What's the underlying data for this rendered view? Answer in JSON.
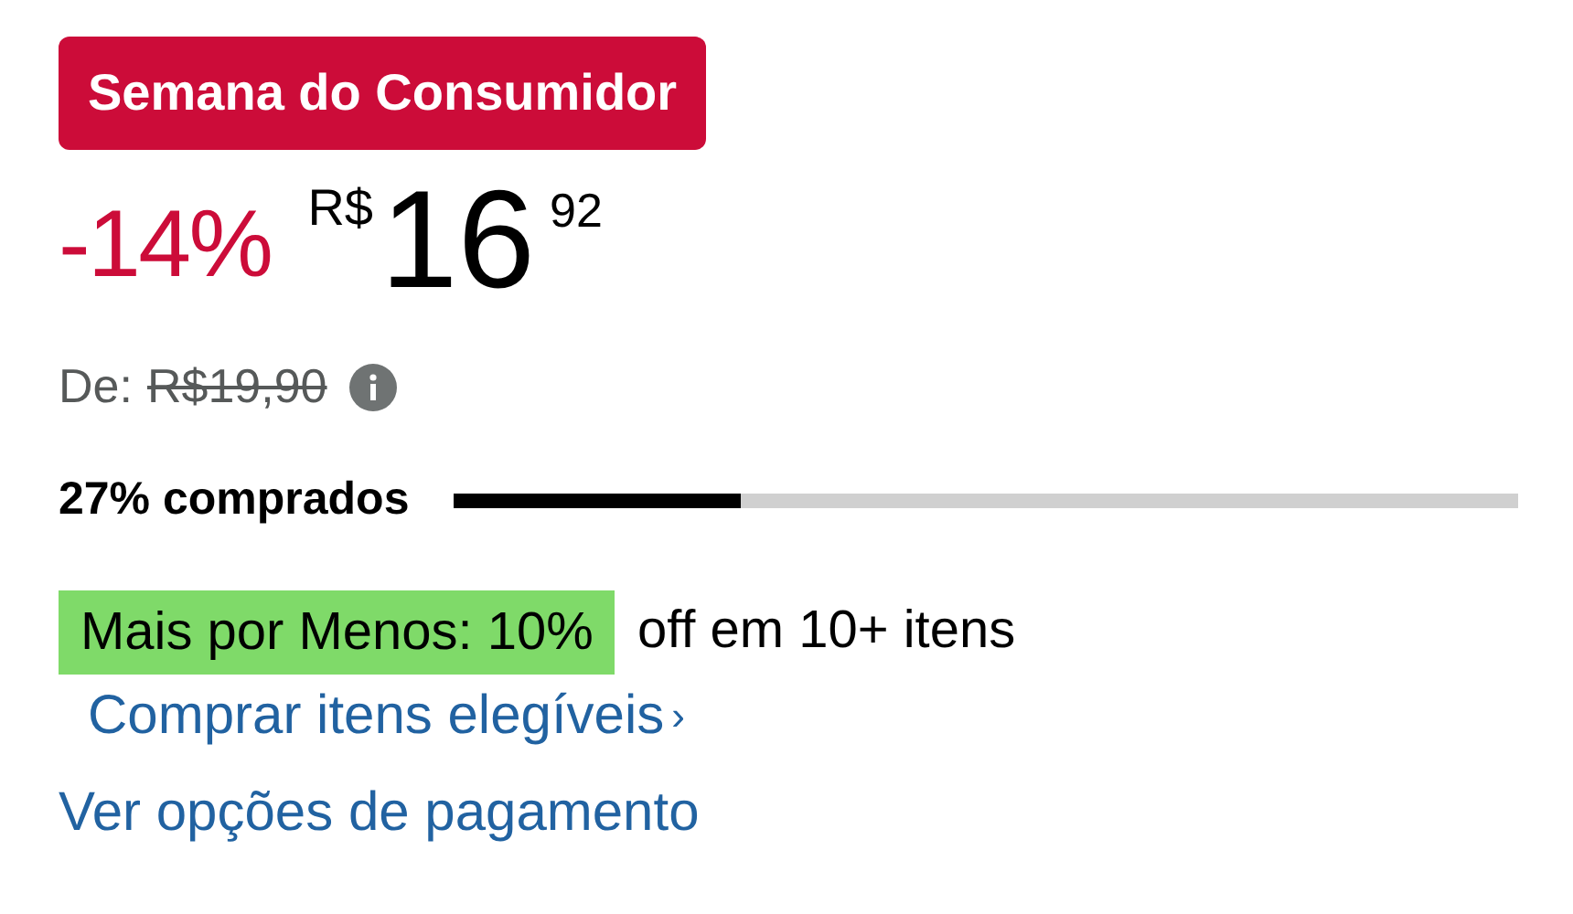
{
  "badge": "Semana do Consumidor",
  "price": {
    "discount": "-14%",
    "currency": "R$",
    "whole": "16",
    "cents": "92"
  },
  "list_price": {
    "label": "De:",
    "value": "R$19,90"
  },
  "claimed": {
    "label": "27% comprados",
    "level": 0.27
  },
  "promo": {
    "highlight": "Mais por Menos: 10%",
    "text": "off em 10+ itens"
  },
  "links": [
    {
      "label": "Comprar itens elegíveis",
      "chevron": "›"
    },
    {
      "label": "Ver opções de pagamento"
    }
  ]
}
